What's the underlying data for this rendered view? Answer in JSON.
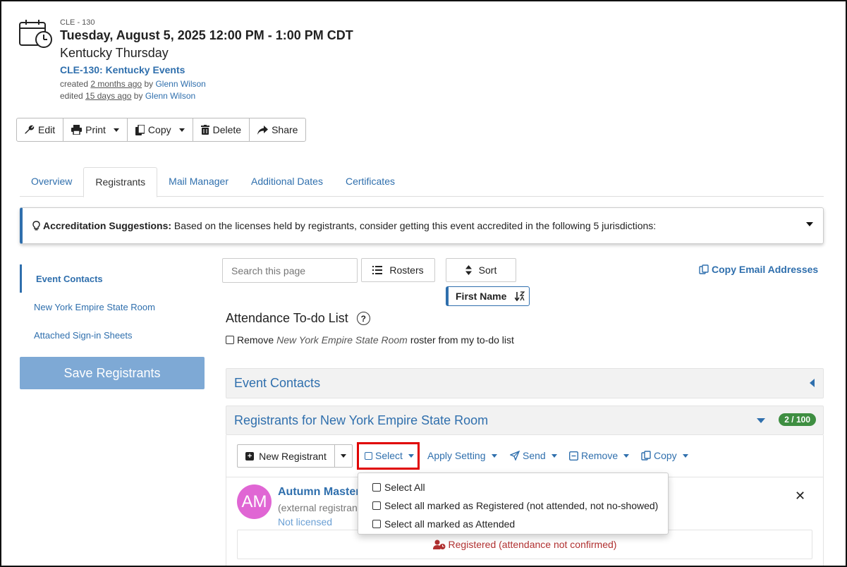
{
  "event": {
    "code": "CLE - 130",
    "datetime": "Tuesday, August 5, 2025 12:00 PM - 1:00 PM CDT",
    "title": "Kentucky Thursday",
    "series_link": "CLE-130: Kentucky Events",
    "created_prefix": "created",
    "created_ago": "2 months ago",
    "created_by_prefix": "by",
    "created_by": "Glenn Wilson",
    "edited_prefix": "edited",
    "edited_ago": "15 days ago",
    "edited_by_prefix": "by",
    "edited_by": "Glenn Wilson"
  },
  "actions": {
    "edit": "Edit",
    "print": "Print",
    "copy": "Copy",
    "delete": "Delete",
    "share": "Share"
  },
  "tabs": [
    "Overview",
    "Registrants",
    "Mail Manager",
    "Additional Dates",
    "Certificates"
  ],
  "accreditation": {
    "label": "Accreditation Suggestions:",
    "text": "Based on the licenses held by registrants, consider getting this event accredited in the following 5 jurisdictions:"
  },
  "left_nav": {
    "items": [
      "Event Contacts",
      "New York Empire State Room",
      "Attached Sign-in Sheets"
    ],
    "save_label": "Save Registrants"
  },
  "search": {
    "placeholder": "Search this page"
  },
  "buttons": {
    "rosters": "Rosters",
    "sort": "Sort",
    "copy_emails": "Copy Email Addresses",
    "sort_field": "First Name"
  },
  "todo": {
    "title": "Attendance To-do List",
    "help": "?",
    "remove_prefix": "Remove",
    "remove_room": "New York Empire State Room",
    "remove_suffix": "roster from my to-do list"
  },
  "panels": {
    "contacts_title": "Event Contacts",
    "registrants_title": "Registrants for New York Empire State Room",
    "count": "2 / 100"
  },
  "reg_toolbar": {
    "new_registrant": "New Registrant",
    "select": "Select",
    "apply_setting": "Apply Setting",
    "send": "Send",
    "remove": "Remove",
    "copy": "Copy"
  },
  "select_menu": {
    "items": [
      "Select All",
      "Select all marked as Registered (not attended, not no-showed)",
      "Select all marked as Attended"
    ]
  },
  "registrant": {
    "initials": "AM",
    "name": "Autumn Masters",
    "subtitle": "(external registrant)",
    "license": "Not licensed",
    "status": "Registered (attendance not confirmed)"
  },
  "colors": {
    "link": "#2f6fad",
    "save_button": "#7ea9d5",
    "badge": "#3e8e41",
    "avatar": "#e066d4",
    "status": "#b03030",
    "highlight": "#e00000"
  }
}
